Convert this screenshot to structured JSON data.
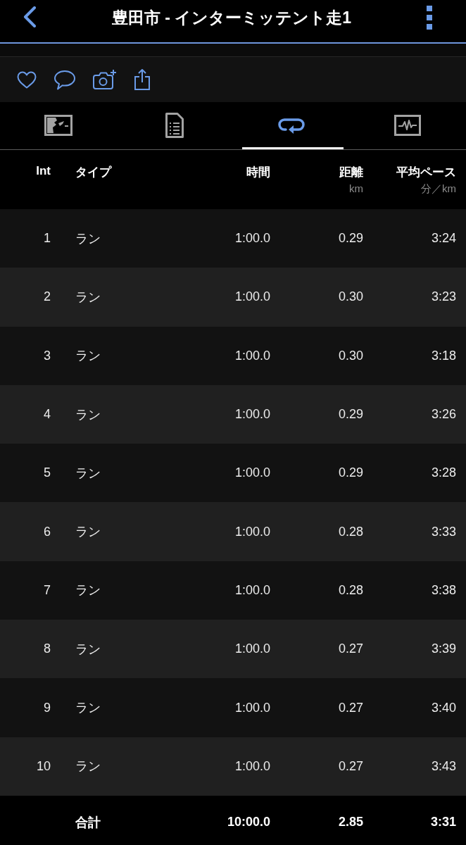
{
  "header": {
    "title": "豊田市 - インターミッテント走1"
  },
  "tabs": [
    {
      "kind": "map",
      "selected": false
    },
    {
      "kind": "details",
      "selected": false
    },
    {
      "kind": "laps",
      "selected": true
    },
    {
      "kind": "graph",
      "selected": false
    }
  ],
  "table": {
    "columns": [
      {
        "label": "Int"
      },
      {
        "label": "タイプ"
      },
      {
        "label": "時間"
      },
      {
        "label": "距離",
        "unit": "km"
      },
      {
        "label": "平均ペース",
        "unit": "分／km"
      }
    ],
    "rows": [
      {
        "cells": [
          "1",
          "ラン",
          "1:00.0",
          "0.29",
          "3:24"
        ]
      },
      {
        "cells": [
          "2",
          "ラン",
          "1:00.0",
          "0.30",
          "3:23"
        ]
      },
      {
        "cells": [
          "3",
          "ラン",
          "1:00.0",
          "0.30",
          "3:18"
        ]
      },
      {
        "cells": [
          "4",
          "ラン",
          "1:00.0",
          "0.29",
          "3:26"
        ]
      },
      {
        "cells": [
          "5",
          "ラン",
          "1:00.0",
          "0.29",
          "3:28"
        ]
      },
      {
        "cells": [
          "6",
          "ラン",
          "1:00.0",
          "0.28",
          "3:33"
        ]
      },
      {
        "cells": [
          "7",
          "ラン",
          "1:00.0",
          "0.28",
          "3:38"
        ]
      },
      {
        "cells": [
          "8",
          "ラン",
          "1:00.0",
          "0.27",
          "3:39"
        ]
      },
      {
        "cells": [
          "9",
          "ラン",
          "1:00.0",
          "0.27",
          "3:40"
        ]
      },
      {
        "cells": [
          "10",
          "ラン",
          "1:00.0",
          "0.27",
          "3:43"
        ]
      }
    ],
    "total": {
      "cells": [
        "合計",
        "10:00.0",
        "2.85",
        "3:31"
      ]
    }
  }
}
